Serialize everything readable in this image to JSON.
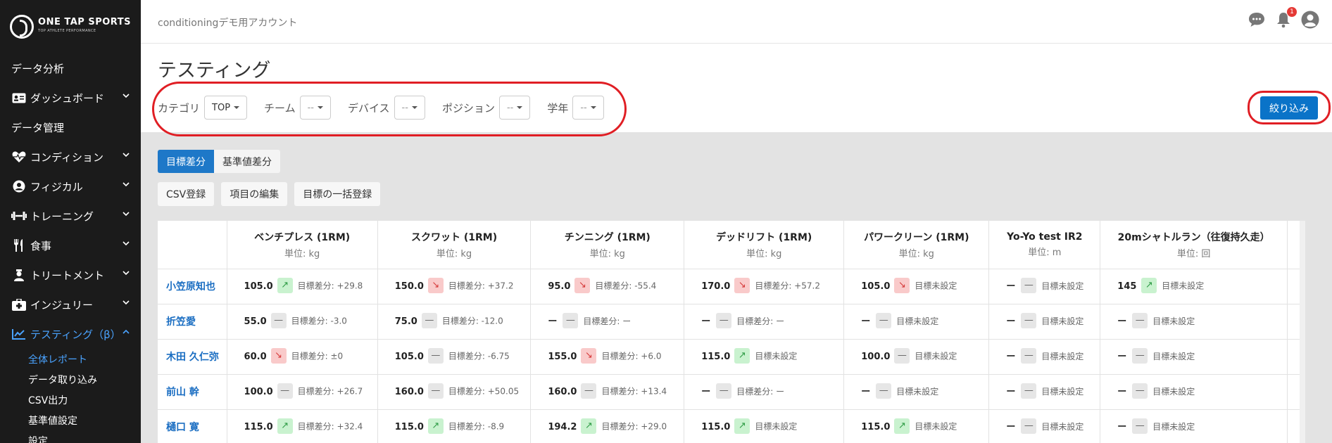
{
  "brand": {
    "name": "ONE TAP SPORTS",
    "tagline": "TOP ATHLETE PERFORMANCE"
  },
  "sidebar": {
    "items": [
      {
        "label": "データ分析",
        "icon": ""
      },
      {
        "label": "ダッシュボード",
        "icon": "id-card-icon",
        "chevron": "down"
      },
      {
        "label": "データ管理",
        "icon": ""
      },
      {
        "label": "コンディション",
        "icon": "heartbeat-icon",
        "chevron": "down"
      },
      {
        "label": "フィジカル",
        "icon": "user-circle-icon",
        "chevron": "down"
      },
      {
        "label": "トレーニング",
        "icon": "dumbbell-icon",
        "chevron": "down"
      },
      {
        "label": "食事",
        "icon": "utensils-icon",
        "chevron": "down"
      },
      {
        "label": "トリートメント",
        "icon": "user-nurse-icon",
        "chevron": "down"
      },
      {
        "label": "インジュリー",
        "icon": "first-aid-icon",
        "chevron": "down"
      },
      {
        "label": "テスティング（β）",
        "icon": "line-chart-icon",
        "chevron": "up",
        "active": true
      }
    ],
    "subitems": [
      {
        "label": "全体レポート",
        "active": true
      },
      {
        "label": "データ取り込み"
      },
      {
        "label": "CSV出力"
      },
      {
        "label": "基準値設定"
      },
      {
        "label": "設定"
      }
    ]
  },
  "topbar": {
    "account": "conditioningデモ用アカウント",
    "notification_count": "1"
  },
  "page": {
    "title": "テスティング"
  },
  "filters": [
    {
      "label": "カテゴリ",
      "value": "TOP"
    },
    {
      "label": "チーム",
      "value": "--"
    },
    {
      "label": "デバイス",
      "value": "--"
    },
    {
      "label": "ポジション",
      "value": "--"
    },
    {
      "label": "学年",
      "value": "--"
    }
  ],
  "apply_label": "絞り込み",
  "toggle": {
    "on": "目標差分",
    "off": "基準値差分"
  },
  "actions": {
    "csv": "CSV登録",
    "edit": "項目の編集",
    "bulk": "目標の一括登録"
  },
  "table": {
    "columns": [
      {
        "title": "ベンチプレス (1RM)",
        "unit": "単位: kg"
      },
      {
        "title": "スクワット (1RM)",
        "unit": "単位: kg"
      },
      {
        "title": "チンニング (1RM)",
        "unit": "単位: kg"
      },
      {
        "title": "デッドリフト (1RM)",
        "unit": "単位: kg"
      },
      {
        "title": "パワークリーン (1RM)",
        "unit": "単位: kg"
      },
      {
        "title": "Yo-Yo test IR2",
        "unit": "単位: m"
      },
      {
        "title": "20mシャトルラン（往復持久走）",
        "unit": "単位: 回"
      }
    ],
    "rows": [
      {
        "name": "小笠原知也",
        "cells": [
          {
            "value": "105.0",
            "trend": "up",
            "diff": "目標差分: +29.8"
          },
          {
            "value": "150.0",
            "trend": "down",
            "diff": "目標差分: +37.2"
          },
          {
            "value": "95.0",
            "trend": "down",
            "diff": "目標差分: -55.4"
          },
          {
            "value": "170.0",
            "trend": "down",
            "diff": "目標差分: +57.2"
          },
          {
            "value": "105.0",
            "trend": "down",
            "diff": "目標未設定"
          },
          {
            "value": "ー",
            "trend": "flat",
            "diff": "目標未設定"
          },
          {
            "value": "145",
            "trend": "up",
            "diff": "目標未設定"
          }
        ]
      },
      {
        "name": "折笠愛",
        "cells": [
          {
            "value": "55.0",
            "trend": "flat",
            "diff": "目標差分: -3.0"
          },
          {
            "value": "75.0",
            "trend": "flat",
            "diff": "目標差分: -12.0"
          },
          {
            "value": "ー",
            "trend": "flat",
            "diff": "目標差分: ー"
          },
          {
            "value": "ー",
            "trend": "flat",
            "diff": "目標差分: ー"
          },
          {
            "value": "ー",
            "trend": "flat",
            "diff": "目標未設定"
          },
          {
            "value": "ー",
            "trend": "flat",
            "diff": "目標未設定"
          },
          {
            "value": "ー",
            "trend": "flat",
            "diff": "目標未設定"
          }
        ]
      },
      {
        "name": "木田 久仁弥",
        "cells": [
          {
            "value": "60.0",
            "trend": "down",
            "diff": "目標差分: ±0"
          },
          {
            "value": "105.0",
            "trend": "flat",
            "diff": "目標差分: -6.75"
          },
          {
            "value": "155.0",
            "trend": "down",
            "diff": "目標差分: +6.0"
          },
          {
            "value": "115.0",
            "trend": "up",
            "diff": "目標未設定"
          },
          {
            "value": "100.0",
            "trend": "flat",
            "diff": "目標未設定"
          },
          {
            "value": "ー",
            "trend": "flat",
            "diff": "目標未設定"
          },
          {
            "value": "ー",
            "trend": "flat",
            "diff": "目標未設定"
          }
        ]
      },
      {
        "name": "前山 幹",
        "cells": [
          {
            "value": "100.0",
            "trend": "flat",
            "diff": "目標差分: +26.7"
          },
          {
            "value": "160.0",
            "trend": "flat",
            "diff": "目標差分: +50.05"
          },
          {
            "value": "160.0",
            "trend": "flat",
            "diff": "目標差分: +13.4"
          },
          {
            "value": "ー",
            "trend": "flat",
            "diff": "目標差分: ー"
          },
          {
            "value": "ー",
            "trend": "flat",
            "diff": "目標未設定"
          },
          {
            "value": "ー",
            "trend": "flat",
            "diff": "目標未設定"
          },
          {
            "value": "ー",
            "trend": "flat",
            "diff": "目標未設定"
          }
        ]
      },
      {
        "name": "樋口 寛",
        "cells": [
          {
            "value": "115.0",
            "trend": "up",
            "diff": "目標差分: +32.4"
          },
          {
            "value": "115.0",
            "trend": "up",
            "diff": "目標差分: -8.9"
          },
          {
            "value": "194.2",
            "trend": "up",
            "diff": "目標差分: +29.0"
          },
          {
            "value": "115.0",
            "trend": "up",
            "diff": "目標未設定"
          },
          {
            "value": "115.0",
            "trend": "up",
            "diff": "目標未設定"
          },
          {
            "value": "ー",
            "trend": "flat",
            "diff": "目標未設定"
          },
          {
            "value": "ー",
            "trend": "flat",
            "diff": "目標未設定"
          }
        ]
      }
    ]
  },
  "colors": {
    "sidebar_bg": "#1b1b1b",
    "accent": "#1e78c8",
    "active_nav": "#4aa3ff",
    "highlight_oval": "#e01e24",
    "trend_up": "#c9f2cf",
    "trend_down": "#f9caca",
    "trend_flat": "#e6e6e6"
  }
}
